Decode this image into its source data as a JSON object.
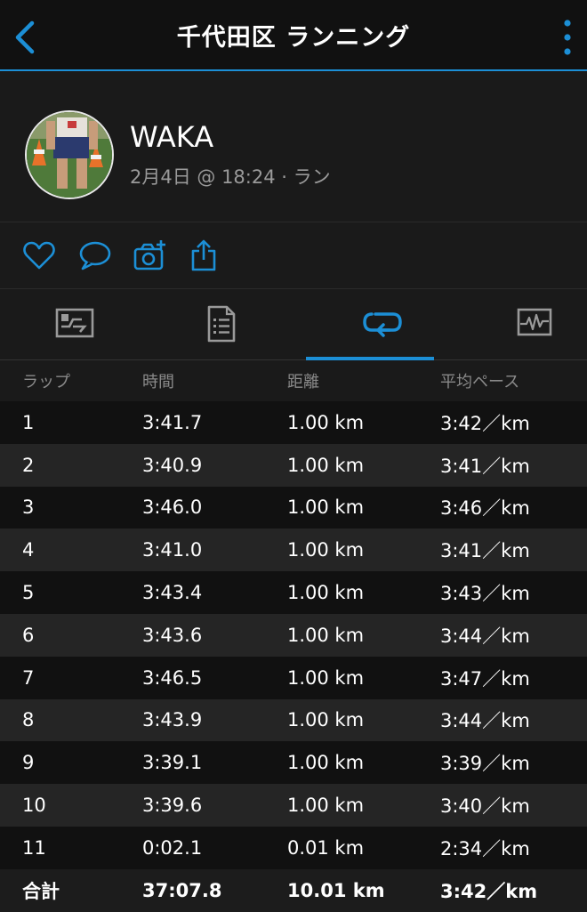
{
  "header": {
    "title": "千代田区 ランニング"
  },
  "profile": {
    "name": "WAKA",
    "meta": "2月4日 @ 18:24 · ラン"
  },
  "colors": {
    "accent": "#1c8fd6",
    "background": "#111111",
    "row_alt": "#252525"
  },
  "actions": [
    {
      "icon": "heart-icon"
    },
    {
      "icon": "comment-icon"
    },
    {
      "icon": "camera-add-icon"
    },
    {
      "icon": "share-icon"
    }
  ],
  "tabs": [
    {
      "icon": "summary-icon",
      "active": false
    },
    {
      "icon": "details-icon",
      "active": false
    },
    {
      "icon": "laps-icon",
      "active": true
    },
    {
      "icon": "chart-icon",
      "active": false
    }
  ],
  "laps": {
    "columns": [
      "ラップ",
      "時間",
      "距離",
      "平均ペース"
    ],
    "rows": [
      [
        "1",
        "3:41.7",
        "1.00 km",
        "3:42／km"
      ],
      [
        "2",
        "3:40.9",
        "1.00 km",
        "3:41／km"
      ],
      [
        "3",
        "3:46.0",
        "1.00 km",
        "3:46／km"
      ],
      [
        "4",
        "3:41.0",
        "1.00 km",
        "3:41／km"
      ],
      [
        "5",
        "3:43.4",
        "1.00 km",
        "3:43／km"
      ],
      [
        "6",
        "3:43.6",
        "1.00 km",
        "3:44／km"
      ],
      [
        "7",
        "3:46.5",
        "1.00 km",
        "3:47／km"
      ],
      [
        "8",
        "3:43.9",
        "1.00 km",
        "3:44／km"
      ],
      [
        "9",
        "3:39.1",
        "1.00 km",
        "3:39／km"
      ],
      [
        "10",
        "3:39.6",
        "1.00 km",
        "3:40／km"
      ],
      [
        "11",
        "0:02.1",
        "0.01 km",
        "2:34／km"
      ]
    ],
    "total": [
      "合計",
      "37:07.8",
      "10.01 km",
      "3:42／km"
    ]
  }
}
